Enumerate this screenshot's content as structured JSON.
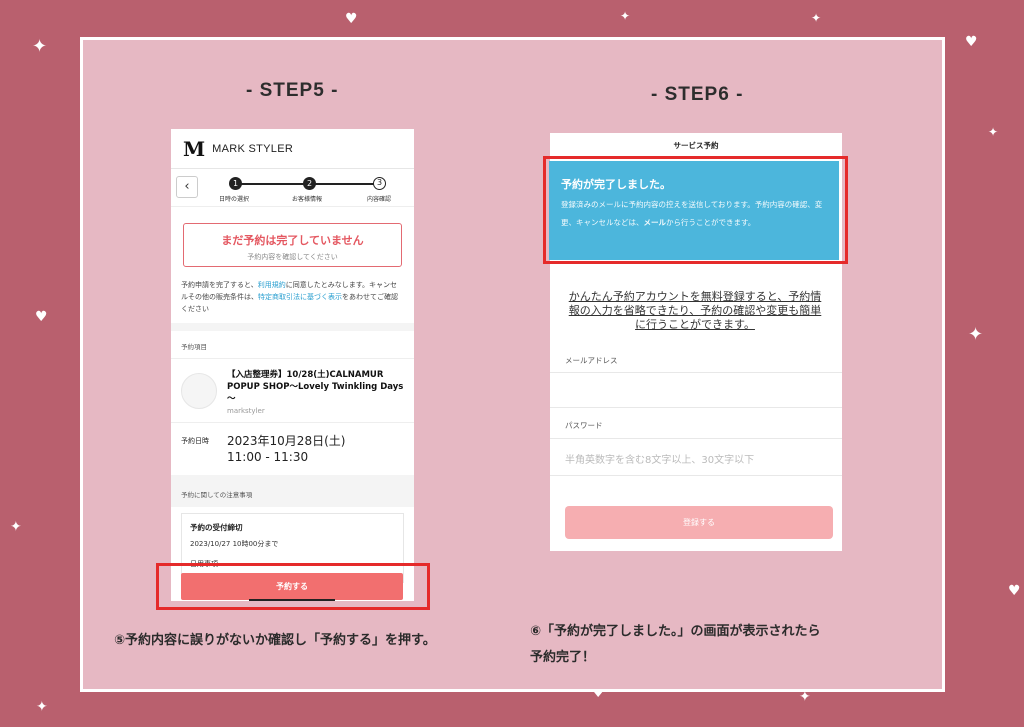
{
  "step5_heading": "- STEP5 -",
  "step6_heading": "- STEP6 -",
  "step5": {
    "logo": "M",
    "brand": "MARK STYLER",
    "progress": [
      "日時の選択",
      "お客様情報",
      "内容確認"
    ],
    "progress_numbers": [
      "1",
      "2",
      "3"
    ],
    "warning_title": "まだ予約は完了していません",
    "warning_sub": "予約内容を確認してください",
    "terms_1": "予約申請を完了すると、",
    "terms_link1": "利用規約",
    "terms_2": "に同意したとみなします。キャンセルその他の販売条件は、",
    "terms_link2": "特定商取引法に基づく表示",
    "terms_3": "をあわせてご確認ください",
    "section_items": "予約項目",
    "item_title": "【入店整理券】10/28(土)CALNAMUR POPUP SHOP～Lovely Twinkling Days～",
    "item_shop": "markstyler",
    "date_label": "予約日時",
    "date_value": "2023年10月28日(土)",
    "time_value": "11:00 - 11:30",
    "section_notes": "予約に関しての注意事項",
    "notice_title": "予約の受付締切",
    "notice_body": "2023/10/27 10時00分まで",
    "notice_cut": "日用事項",
    "reserve_button": "予約する"
  },
  "step6": {
    "top_title": "サービス予約",
    "complete_title": "予約が完了しました。",
    "complete_body_1": "登録済みのメールに予約内容の控えを送信しております。予約内容の確認、変更、キャンセルなどは、",
    "complete_body_mail": "メール",
    "complete_body_2": "から行うことができます。",
    "promo": "かんたん予約アカウントを無料登録すると、予約情報の入力を省略できたり、予約の確認や変更も簡単に行うことができます。",
    "email_label": "メールアドレス",
    "password_label": "パスワード",
    "password_placeholder": "半角英数字を含む8文字以上、30文字以下",
    "register_button": "登録する"
  },
  "caption5": "⑤予約内容に誤りがないか確認し「予約する」を押す。",
  "caption6_1": "⑥「予約が完了しました。」の画面が表示されたら",
  "caption6_2": "予約完了！",
  "colors": {
    "background": "#b9606e",
    "panel": "#e6b8c3",
    "accent_red": "#e52a2a",
    "blue": "#4cb6dc",
    "button": "#f26f6f"
  }
}
